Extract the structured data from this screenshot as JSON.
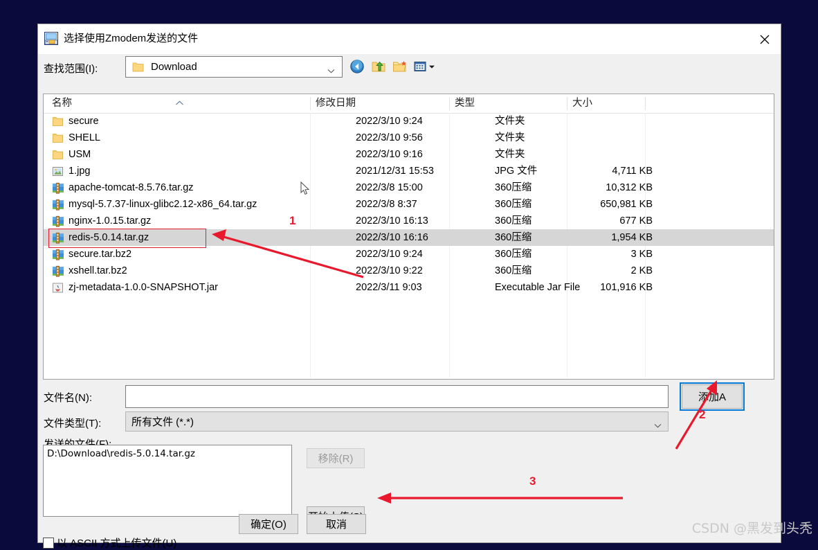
{
  "window": {
    "title": "选择使用Zmodem发送的文件",
    "icon": "zmodem-send-icon",
    "close_icon": "close-icon"
  },
  "lookin": {
    "label": "查找范围(I):",
    "value": "Download",
    "folder_icon": "folder-icon",
    "caret_icon": "chevron-down-icon"
  },
  "toolbar": {
    "items": [
      {
        "name": "back-icon",
        "tooltip": "后退"
      },
      {
        "name": "up-one-level-icon",
        "tooltip": "上一级"
      },
      {
        "name": "new-folder-icon",
        "tooltip": "新建文件夹"
      },
      {
        "name": "views-icon",
        "tooltip": "查看"
      }
    ]
  },
  "filelist": {
    "columns": [
      "名称",
      "修改日期",
      "类型",
      "大小"
    ],
    "sort_column": "名称",
    "sort_direction": "asc",
    "rows": [
      {
        "name": "secure",
        "icon": "folder-icon",
        "date": "2022/3/10 9:24",
        "type": "文件夹",
        "size": "",
        "selected": false
      },
      {
        "name": "SHELL",
        "icon": "folder-icon",
        "date": "2022/3/10 9:56",
        "type": "文件夹",
        "size": "",
        "selected": false
      },
      {
        "name": "USM",
        "icon": "folder-icon",
        "date": "2022/3/10 9:16",
        "type": "文件夹",
        "size": "",
        "selected": false
      },
      {
        "name": "1.jpg",
        "icon": "image-icon",
        "date": "2021/12/31 15:53",
        "type": "JPG 文件",
        "size": "4,711 KB",
        "selected": false
      },
      {
        "name": "apache-tomcat-8.5.76.tar.gz",
        "icon": "archive-icon",
        "date": "2022/3/8 15:00",
        "type": "360压缩",
        "size": "10,312 KB",
        "selected": false
      },
      {
        "name": "mysql-5.7.37-linux-glibc2.12-x86_64.tar.gz",
        "icon": "archive-icon",
        "date": "2022/3/8 8:37",
        "type": "360压缩",
        "size": "650,981 KB",
        "selected": false
      },
      {
        "name": "nginx-1.0.15.tar.gz",
        "icon": "archive-icon",
        "date": "2022/3/10 16:13",
        "type": "360压缩",
        "size": "677 KB",
        "selected": false
      },
      {
        "name": "redis-5.0.14.tar.gz",
        "icon": "archive-icon",
        "date": "2022/3/10 16:16",
        "type": "360压缩",
        "size": "1,954 KB",
        "selected": true
      },
      {
        "name": "secure.tar.bz2",
        "icon": "archive-icon",
        "date": "2022/3/10 9:24",
        "type": "360压缩",
        "size": "3 KB",
        "selected": false
      },
      {
        "name": "xshell.tar.bz2",
        "icon": "archive-icon",
        "date": "2022/3/10 9:22",
        "type": "360压缩",
        "size": "2 KB",
        "selected": false
      },
      {
        "name": "zj-metadata-1.0.0-SNAPSHOT.jar",
        "icon": "java-jar-icon",
        "date": "2022/3/11 9:03",
        "type": "Executable Jar File",
        "size": "101,916 KB",
        "selected": false
      }
    ]
  },
  "form": {
    "filename_label": "文件名(N):",
    "filename_value": "",
    "filetype_label": "文件类型(T):",
    "filetype_value": "所有文件 (*.*)",
    "sendfiles_label": "发送的文件(F):",
    "sendfiles_items": [
      "D:\\Download\\redis-5.0.14.tar.gz"
    ],
    "ascii_checkbox_label": "以 ASCII 方式上传文件(U)",
    "ascii_checked": false
  },
  "buttons": {
    "add": "添加A",
    "remove": "移除(R)",
    "start_upload": "开始上传(S)",
    "ok": "确定(O)",
    "cancel": "取消"
  },
  "annotations": {
    "markers": [
      "1",
      "2",
      "3"
    ],
    "arrow_color": "#e8192c",
    "highlight_color": "#e8192c",
    "focus_color": "#0078d7"
  },
  "watermark": "CSDN @黑发到头秃"
}
